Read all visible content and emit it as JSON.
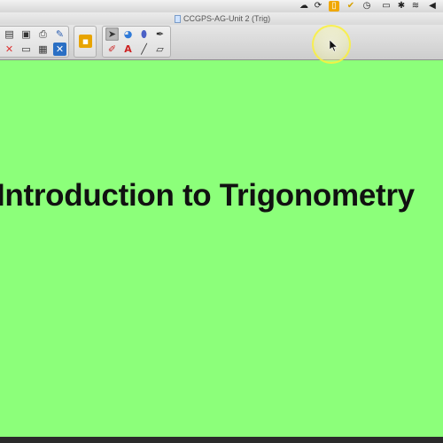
{
  "window": {
    "title": "CCGPS-AG-Unit 2 (Trig)"
  },
  "menubar": {
    "status_icons": [
      "cloud-icon",
      "sync-icon",
      "clipboard-icon",
      "checkmark-icon",
      "clock-icon",
      "time-machine-icon",
      "display-icon",
      "bluetooth-icon",
      "wifi-icon",
      "volume-icon"
    ]
  },
  "toolbar": {
    "groups": [
      {
        "name": "file-tools",
        "icons": [
          "new-page-icon",
          "open-file-icon",
          "save-icon",
          "print-icon",
          "delete-icon",
          "fullscreen-icon",
          "table-icon",
          "close-page-icon"
        ]
      },
      {
        "name": "lock-tools",
        "icons": [
          "lock-icon"
        ]
      },
      {
        "name": "draw-tools",
        "icons": [
          "select-arrow-icon",
          "fill-icon",
          "highlighter-icon",
          "magic-pen-icon",
          "pens-icon",
          "text-icon",
          "line-icon",
          "eraser-icon"
        ]
      }
    ]
  },
  "slide": {
    "title": "Introduction to Trigonometry",
    "background_color": "#8cff7a"
  },
  "colors": {
    "slide_bg": "#8cff7a",
    "cursor_halo": "#faf03c"
  }
}
